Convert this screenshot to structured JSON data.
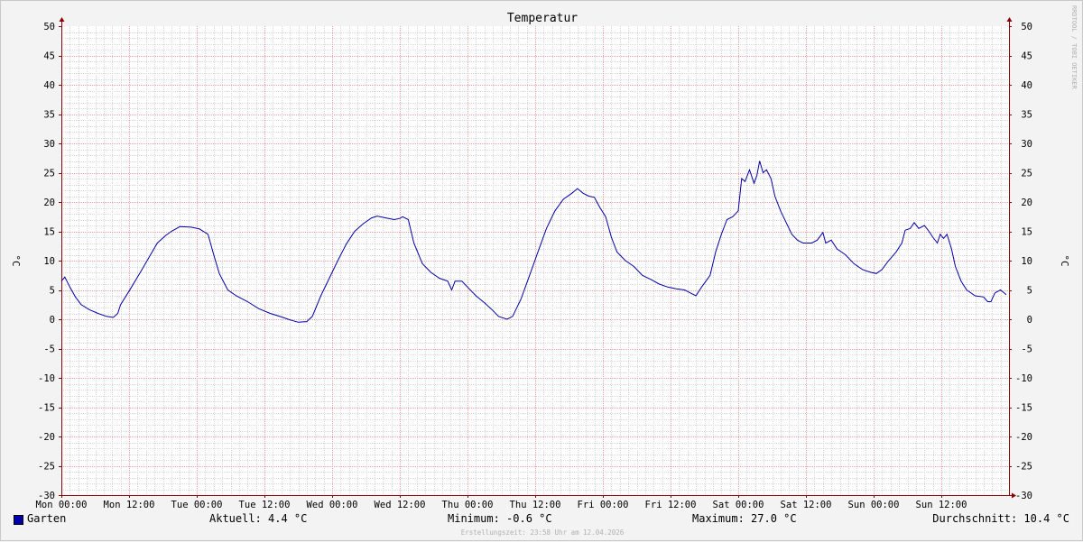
{
  "chart_data": {
    "type": "line",
    "title": "Temperatur",
    "ylabel": "°C",
    "ylim": [
      -30,
      50
    ],
    "yticks": [
      50,
      45,
      40,
      35,
      30,
      25,
      20,
      15,
      10,
      5,
      0,
      -5,
      -10,
      -15,
      -20,
      -25,
      -30
    ],
    "xlim": [
      0,
      168
    ],
    "x_unit": "hours since Mon 00:00",
    "xtick_labels": [
      "Mon 00:00",
      "Mon 12:00",
      "Tue 00:00",
      "Tue 12:00",
      "Wed 00:00",
      "Wed 12:00",
      "Thu 00:00",
      "Thu 12:00",
      "Fri 00:00",
      "Fri 12:00",
      "Sat 00:00",
      "Sat 12:00",
      "Sun 00:00",
      "Sun 12:00"
    ],
    "grid": true,
    "colors": {
      "line": "#0000aa",
      "grid_major": "#e8a0a0",
      "grid_minor": "#d8d8d8",
      "axis": "#8b0000",
      "plot_bg": "#ffffff"
    },
    "series": [
      {
        "name": "Garten",
        "points": [
          [
            0,
            6.5
          ],
          [
            0.6,
            7.2
          ],
          [
            1.5,
            5.5
          ],
          [
            2.5,
            3.8
          ],
          [
            3.5,
            2.5
          ],
          [
            5,
            1.6
          ],
          [
            6.5,
            1.0
          ],
          [
            8,
            0.5
          ],
          [
            9.2,
            0.3
          ],
          [
            10,
            1.0
          ],
          [
            10.5,
            2.5
          ],
          [
            12,
            4.8
          ],
          [
            14,
            8.0
          ],
          [
            15.5,
            10.5
          ],
          [
            17,
            13.0
          ],
          [
            18.5,
            14.3
          ],
          [
            19.5,
            15.0
          ],
          [
            21,
            15.8
          ],
          [
            23,
            15.7
          ],
          [
            24.5,
            15.4
          ],
          [
            26,
            14.5
          ],
          [
            27,
            11.0
          ],
          [
            28,
            7.8
          ],
          [
            29.5,
            5.0
          ],
          [
            31,
            4.0
          ],
          [
            33,
            3.0
          ],
          [
            35,
            1.8
          ],
          [
            37,
            1.0
          ],
          [
            39,
            0.4
          ],
          [
            40.5,
            -0.1
          ],
          [
            42,
            -0.5
          ],
          [
            43.5,
            -0.4
          ],
          [
            44.5,
            0.5
          ],
          [
            46,
            4.0
          ],
          [
            47.5,
            7.0
          ],
          [
            49,
            10.0
          ],
          [
            50.5,
            12.8
          ],
          [
            52,
            15.0
          ],
          [
            53.5,
            16.3
          ],
          [
            55,
            17.3
          ],
          [
            56,
            17.6
          ],
          [
            57.5,
            17.3
          ],
          [
            59,
            17.0
          ],
          [
            60,
            17.2
          ],
          [
            60.5,
            17.5
          ],
          [
            61.5,
            17.0
          ],
          [
            62.5,
            13.0
          ],
          [
            64,
            9.5
          ],
          [
            65.5,
            8.0
          ],
          [
            67,
            7.0
          ],
          [
            68.5,
            6.5
          ],
          [
            69.2,
            5.0
          ],
          [
            69.8,
            6.5
          ],
          [
            71,
            6.5
          ],
          [
            72,
            5.5
          ],
          [
            73.5,
            4.0
          ],
          [
            75,
            2.8
          ],
          [
            76.5,
            1.5
          ],
          [
            77.5,
            0.5
          ],
          [
            79,
            0.0
          ],
          [
            80,
            0.5
          ],
          [
            81.5,
            3.5
          ],
          [
            83,
            7.5
          ],
          [
            84.5,
            11.5
          ],
          [
            86,
            15.5
          ],
          [
            87.5,
            18.5
          ],
          [
            89,
            20.5
          ],
          [
            90.5,
            21.5
          ],
          [
            91.5,
            22.3
          ],
          [
            92.5,
            21.5
          ],
          [
            93.5,
            21.0
          ],
          [
            94.5,
            20.8
          ],
          [
            95.5,
            19.0
          ],
          [
            96.5,
            17.5
          ],
          [
            97.5,
            14.0
          ],
          [
            98.5,
            11.5
          ],
          [
            100,
            10.0
          ],
          [
            101.5,
            9.0
          ],
          [
            103,
            7.5
          ],
          [
            104.5,
            6.8
          ],
          [
            106,
            6.0
          ],
          [
            107.5,
            5.5
          ],
          [
            109,
            5.2
          ],
          [
            110.5,
            5.0
          ],
          [
            111.5,
            4.5
          ],
          [
            112.5,
            4.0
          ],
          [
            113.5,
            5.5
          ],
          [
            115,
            7.5
          ],
          [
            116,
            11.5
          ],
          [
            117,
            14.5
          ],
          [
            118,
            17.0
          ],
          [
            119,
            17.5
          ],
          [
            120,
            18.5
          ],
          [
            120.6,
            24.0
          ],
          [
            121.2,
            23.5
          ],
          [
            122,
            25.5
          ],
          [
            122.8,
            23.2
          ],
          [
            123.3,
            24.5
          ],
          [
            123.8,
            27.0
          ],
          [
            124.4,
            25.0
          ],
          [
            125,
            25.5
          ],
          [
            125.8,
            24.0
          ],
          [
            126.5,
            21.0
          ],
          [
            127.5,
            18.5
          ],
          [
            128.5,
            16.5
          ],
          [
            129.5,
            14.5
          ],
          [
            130.5,
            13.5
          ],
          [
            131.5,
            13.0
          ],
          [
            133,
            13.0
          ],
          [
            134,
            13.5
          ],
          [
            135,
            14.8
          ],
          [
            135.5,
            13.0
          ],
          [
            136.5,
            13.5
          ],
          [
            137.5,
            12.0
          ],
          [
            139,
            11.0
          ],
          [
            140.5,
            9.5
          ],
          [
            142,
            8.5
          ],
          [
            143.5,
            8.0
          ],
          [
            144.5,
            7.8
          ],
          [
            145.5,
            8.5
          ],
          [
            146.5,
            9.8
          ],
          [
            148,
            11.5
          ],
          [
            149,
            13.0
          ],
          [
            149.6,
            15.2
          ],
          [
            150.5,
            15.5
          ],
          [
            151.2,
            16.5
          ],
          [
            152,
            15.5
          ],
          [
            153,
            16.0
          ],
          [
            153.8,
            15.0
          ],
          [
            154.5,
            14.0
          ],
          [
            155.3,
            13.0
          ],
          [
            155.8,
            14.5
          ],
          [
            156.4,
            13.8
          ],
          [
            157,
            14.5
          ],
          [
            157.8,
            12.0
          ],
          [
            158.5,
            9.0
          ],
          [
            159.5,
            6.5
          ],
          [
            160.5,
            5.0
          ],
          [
            162,
            4.0
          ],
          [
            163.5,
            3.8
          ],
          [
            164.2,
            3.0
          ],
          [
            164.8,
            3.0
          ],
          [
            165.5,
            4.5
          ],
          [
            166.5,
            5.0
          ],
          [
            167.5,
            4.2
          ]
        ]
      }
    ],
    "legend": {
      "series_name": "Garten",
      "aktuell": "Aktuell: 4.4 °C",
      "minimum": "Minimum: -0.6 °C",
      "maximum": "Maximum: 27.0 °C",
      "durchschnitt": "Durchschnitt: 10.4 °C"
    }
  },
  "watermark": "RRDTOOL / TOBI OETIKER",
  "footer": "Erstellungszeit: 23:58 Uhr am 12.04.2026"
}
